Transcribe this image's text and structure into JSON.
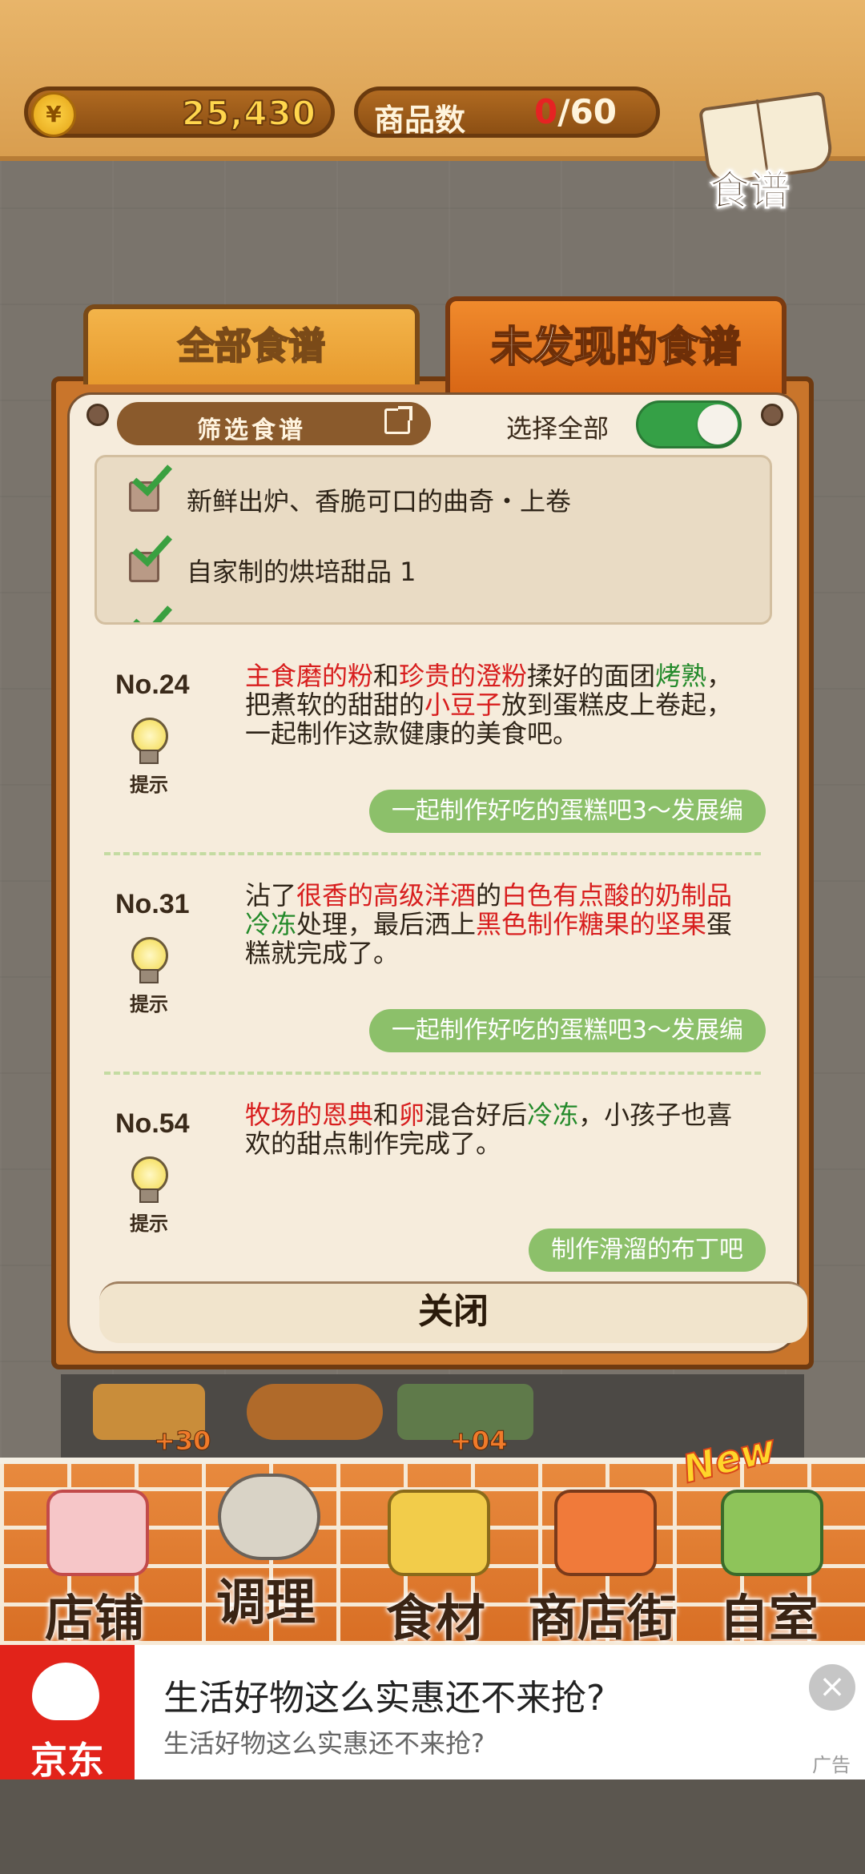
{
  "header": {
    "coin_icon": "¥",
    "coins": "25,430",
    "items_label": "商品数",
    "items_current": "0",
    "items_separator": "/",
    "items_max": "60",
    "recipe_book_label": "食谱"
  },
  "tabs": [
    {
      "label": "全部食谱",
      "active": false
    },
    {
      "label": "未发现的食谱",
      "active": true
    }
  ],
  "filter": {
    "button_label": "筛选食谱",
    "select_all_label": "选择全部",
    "select_all_on": true
  },
  "checklist": [
    {
      "label": "新鲜出炉、香脆可口的曲奇・上卷",
      "checked": true
    },
    {
      "label": "自家制的烘培甜品 1",
      "checked": true
    },
    {
      "label": "",
      "checked": true
    }
  ],
  "recipes": [
    {
      "number": "No.24",
      "hint_label": "提示",
      "desc_parts": [
        {
          "text": "主食磨的粉",
          "color": "red"
        },
        {
          "text": "和",
          "color": "plain"
        },
        {
          "text": "珍贵的澄粉",
          "color": "red"
        },
        {
          "text": "揉好的面团",
          "color": "plain"
        },
        {
          "text": "烤熟",
          "color": "green"
        },
        {
          "text": "，把煮软的甜甜的",
          "color": "plain"
        },
        {
          "text": "小豆子",
          "color": "red"
        },
        {
          "text": "放到蛋糕皮上卷起，一起制作这款健康的美食吧。",
          "color": "plain"
        }
      ],
      "source": "一起制作好吃的蛋糕吧3～发展编"
    },
    {
      "number": "No.31",
      "hint_label": "提示",
      "desc_parts": [
        {
          "text": "沾了",
          "color": "plain"
        },
        {
          "text": "很香的高级洋酒",
          "color": "red"
        },
        {
          "text": "的",
          "color": "plain"
        },
        {
          "text": "白色有点酸的奶制品",
          "color": "red"
        },
        {
          "text": "冷冻",
          "color": "green"
        },
        {
          "text": "处理，最后洒上",
          "color": "plain"
        },
        {
          "text": "黑色制作糖果的坚果",
          "color": "red"
        },
        {
          "text": "蛋糕就完成了。",
          "color": "plain"
        }
      ],
      "source": "一起制作好吃的蛋糕吧3～发展编"
    },
    {
      "number": "No.54",
      "hint_label": "提示",
      "desc_parts": [
        {
          "text": "牧场的恩典",
          "color": "red"
        },
        {
          "text": "和",
          "color": "plain"
        },
        {
          "text": "卵",
          "color": "red"
        },
        {
          "text": "混合好后",
          "color": "plain"
        },
        {
          "text": "冷冻",
          "color": "green"
        },
        {
          "text": "，小孩子也喜欢的甜点制作完成了。",
          "color": "plain"
        }
      ],
      "source": "制作滑溜的布丁吧"
    }
  ],
  "close_label": "关闭",
  "shelf": [
    {
      "plus": "+30"
    },
    {
      "plus": ""
    },
    {
      "plus": "+04"
    }
  ],
  "nav": [
    {
      "label": "店铺",
      "icon": "cake-icon"
    },
    {
      "label": "调理",
      "icon": "mixing-bowl-icon"
    },
    {
      "label": "食材",
      "icon": "flour-sack-icon"
    },
    {
      "label": "商店街",
      "icon": "shop-icon"
    },
    {
      "label": "自室",
      "icon": "staff-door-icon"
    }
  ],
  "new_badge": "New",
  "ad": {
    "brand": "京东",
    "title": "生活好物这么实惠还不来抢?",
    "subtitle": "生活好物这么实惠还不来抢?",
    "close": "×",
    "tag": "广告"
  },
  "colors": {
    "keyword_red": "#d81e1e",
    "keyword_green": "#238a2a",
    "source_pill": "#8cc06a",
    "toggle_on": "#35a046",
    "tab_active": "#d86615"
  }
}
